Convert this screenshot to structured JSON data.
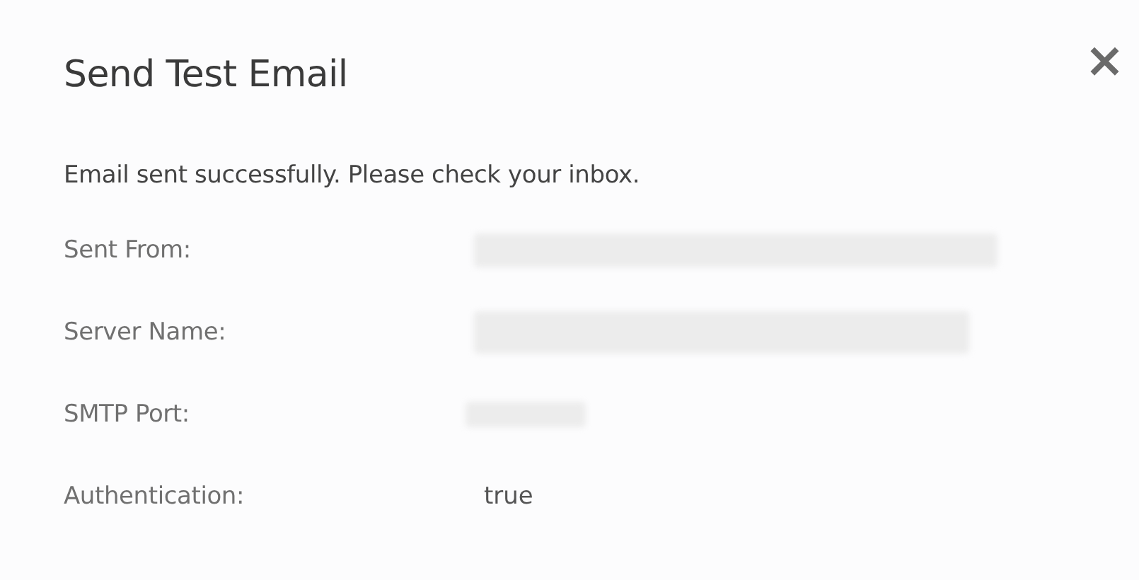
{
  "dialog": {
    "title": "Send Test Email",
    "close": "×",
    "message": "Email sent successfully. Please check your inbox.",
    "rows": [
      {
        "label": "Sent From:",
        "kind": "redacted"
      },
      {
        "label": "Server Name:",
        "kind": "redacted"
      },
      {
        "label": "SMTP Port:",
        "kind": "redacted"
      },
      {
        "label": "Authentication:",
        "kind": "text",
        "value": "true"
      }
    ]
  }
}
